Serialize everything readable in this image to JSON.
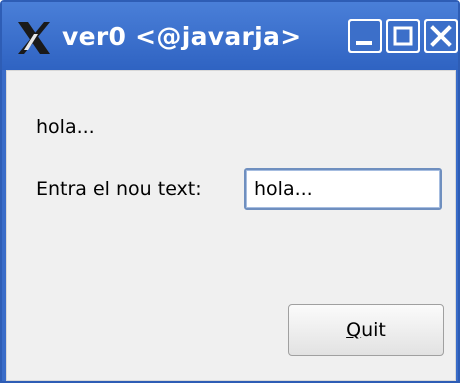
{
  "window": {
    "title": "ver0 <@javarja>",
    "app_icon": "x-window-icon",
    "controls": {
      "minimize_icon": "minimize-icon",
      "maximize_icon": "maximize-icon",
      "close_icon": "close-icon"
    },
    "colors": {
      "titlebar": "#3a6cc8",
      "client_bg": "#f0f0f0"
    }
  },
  "content": {
    "display_label": "hola...",
    "entry_label": "Entra el nou text:",
    "text_input_value": "hola...",
    "quit_button": {
      "mnemonic": "Q",
      "rest": "uit"
    }
  }
}
